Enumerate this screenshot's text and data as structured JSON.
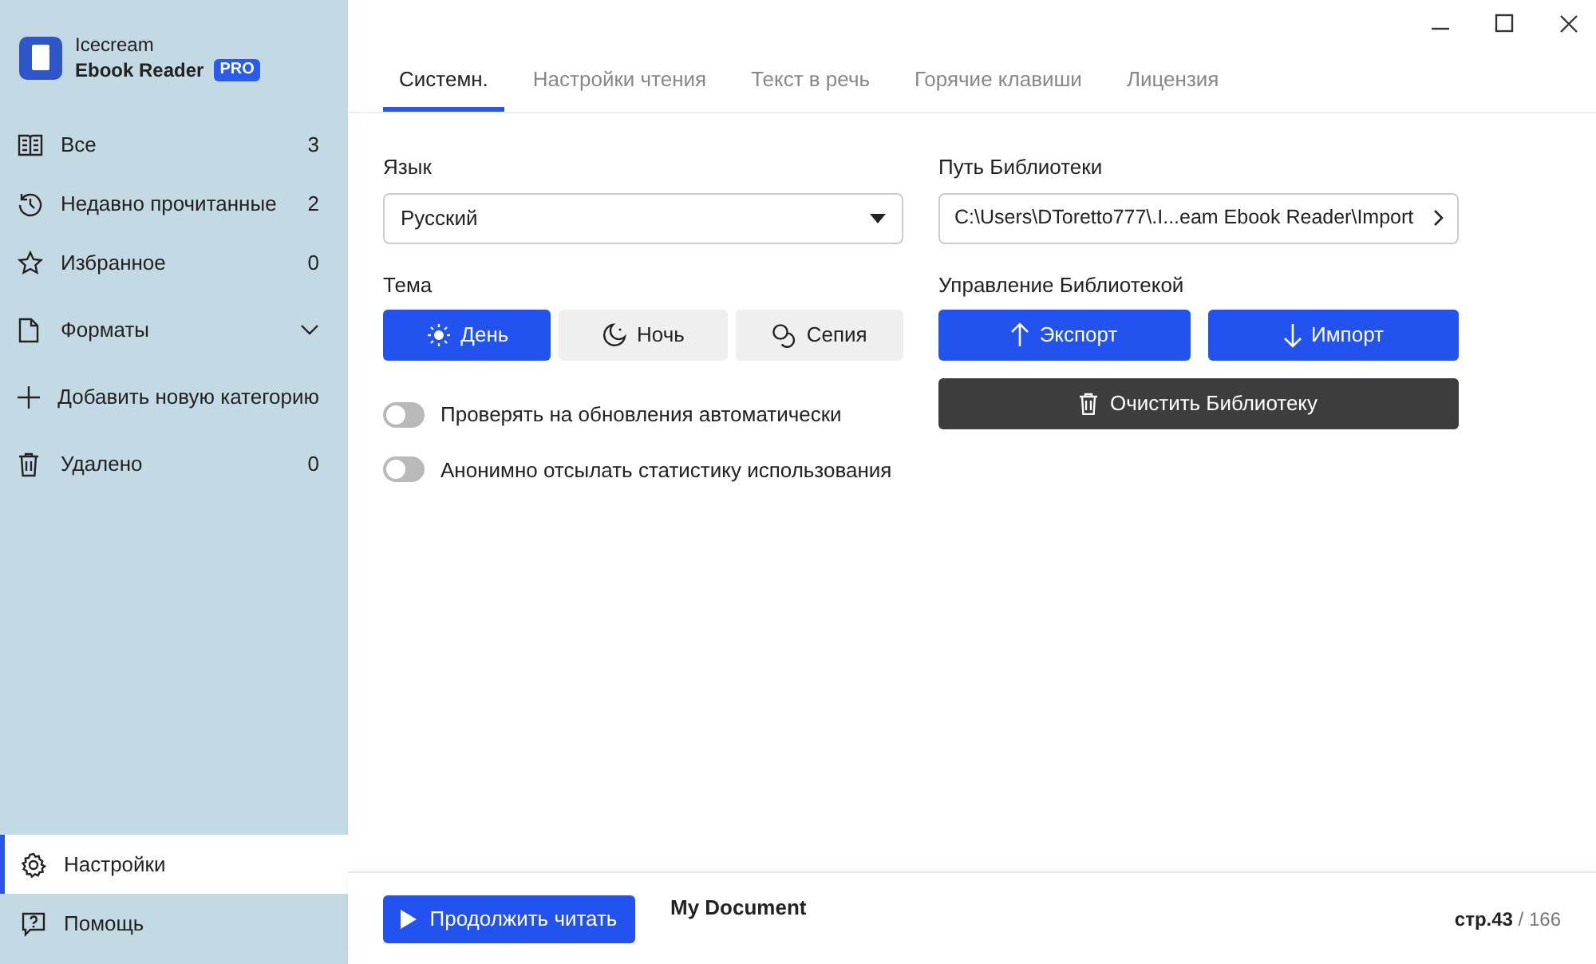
{
  "app": {
    "name": "Icecream",
    "product": "Ebook Reader",
    "badge": "PRO"
  },
  "sidebar": {
    "items": [
      {
        "kind": "category",
        "label": "Все",
        "count": "3"
      },
      {
        "kind": "category",
        "label": "Недавно прочитанные",
        "count": "2"
      },
      {
        "kind": "category",
        "label": "Избранное",
        "count": "0"
      },
      {
        "kind": "group",
        "label": "Форматы",
        "expanded": false
      },
      {
        "kind": "action",
        "label": "Добавить новую категорию"
      },
      {
        "kind": "category",
        "label": "Удалено",
        "count": "0"
      }
    ],
    "bottom_items": [
      {
        "label": "Настройки",
        "selected": true
      },
      {
        "label": "Помощь",
        "selected": false
      }
    ]
  },
  "tabs": [
    {
      "label": "Системн.",
      "selected": true
    },
    {
      "label": "Настройки чтения",
      "selected": false
    },
    {
      "label": "Текст в речь",
      "selected": false
    },
    {
      "label": "Горячие клавиши",
      "selected": false
    },
    {
      "label": "Лицензия",
      "selected": false
    }
  ],
  "language": {
    "label": "Язык",
    "value": "Русский"
  },
  "theme": {
    "label": "Тема",
    "options": [
      {
        "label": "День",
        "selected": true
      },
      {
        "label": "Ночь",
        "selected": false
      },
      {
        "label": "Сепия",
        "selected": false
      }
    ]
  },
  "toggles": [
    {
      "label": "Проверять на обновления автоматически",
      "on": false
    },
    {
      "label": "Анонимно отсылать статистику использования",
      "on": false
    }
  ],
  "library_path": {
    "label": "Путь Библиотеки",
    "value": "C:\\Users\\DToretto777\\.I...eam Ebook Reader\\Import"
  },
  "library_management": {
    "label": "Управление Библиотекой",
    "export": "Экспорт",
    "import": "Импорт",
    "clear": "Очистить Библиотеку"
  },
  "footer": {
    "continue": "Продолжить читать",
    "document": "My Document",
    "page": "стр.43",
    "total": "/ 166"
  }
}
